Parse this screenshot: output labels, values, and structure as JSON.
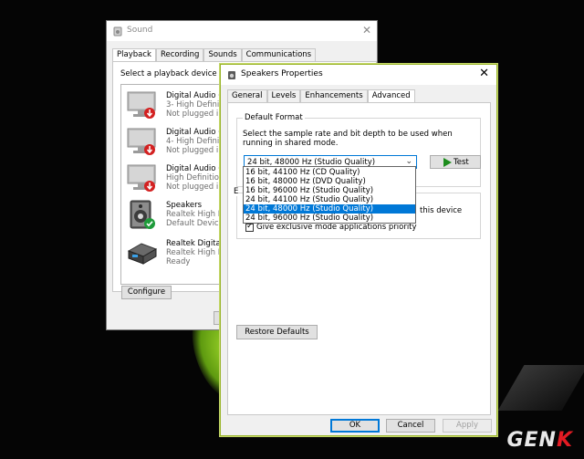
{
  "watermark": {
    "text_main": "GEN",
    "text_accent": "K"
  },
  "sound_dialog": {
    "title": "Sound",
    "close_glyph": "✕",
    "tabs": [
      "Playback",
      "Recording",
      "Sounds",
      "Communications"
    ],
    "instruction": "Select a playback device belo",
    "devices": [
      {
        "name": "Digital Audio (H",
        "line2": "3- High Definiti",
        "line3": "Not plugged in",
        "status": "unplugged"
      },
      {
        "name": "Digital Audio (H",
        "line2": "4- High Definiti",
        "line3": "Not plugged in",
        "status": "unplugged"
      },
      {
        "name": "Digital Audio (H",
        "line2": "High Definition",
        "line3": "Not plugged in",
        "status": "unplugged"
      },
      {
        "name": "Speakers",
        "line2": "Realtek High De",
        "line3": "Default Device",
        "status": "default"
      },
      {
        "name": "Realtek Digital C",
        "line2": "Realtek High De",
        "line3": "Ready",
        "status": "ready"
      }
    ],
    "configure_label": "Configure"
  },
  "props_dialog": {
    "title": "Speakers Properties",
    "close_glyph": "✕",
    "tabs": [
      "General",
      "Levels",
      "Enhancements",
      "Advanced"
    ],
    "default_format_title": "Default Format",
    "default_format_desc": "Select the sample rate and bit depth to be used when running in shared mode.",
    "selected_format": "24 bit, 48000 Hz (Studio Quality)",
    "test_label": "Test",
    "formats": [
      "16 bit, 44100 Hz (CD Quality)",
      "16 bit, 48000 Hz (DVD Quality)",
      "16 bit, 96000 Hz (Studio Quality)",
      "24 bit, 44100 Hz (Studio Quality)",
      "24 bit, 48000 Hz (Studio Quality)",
      "24 bit, 96000 Hz (Studio Quality)"
    ],
    "selected_index": 4,
    "exclusive_group_partial": "E",
    "exclusive_row1_tail": "this device",
    "exclusive_row2_label": "Give exclusive mode applications priority",
    "restore_label": "Restore Defaults",
    "ok_label": "OK",
    "cancel_label": "Cancel",
    "apply_label": "Apply"
  }
}
